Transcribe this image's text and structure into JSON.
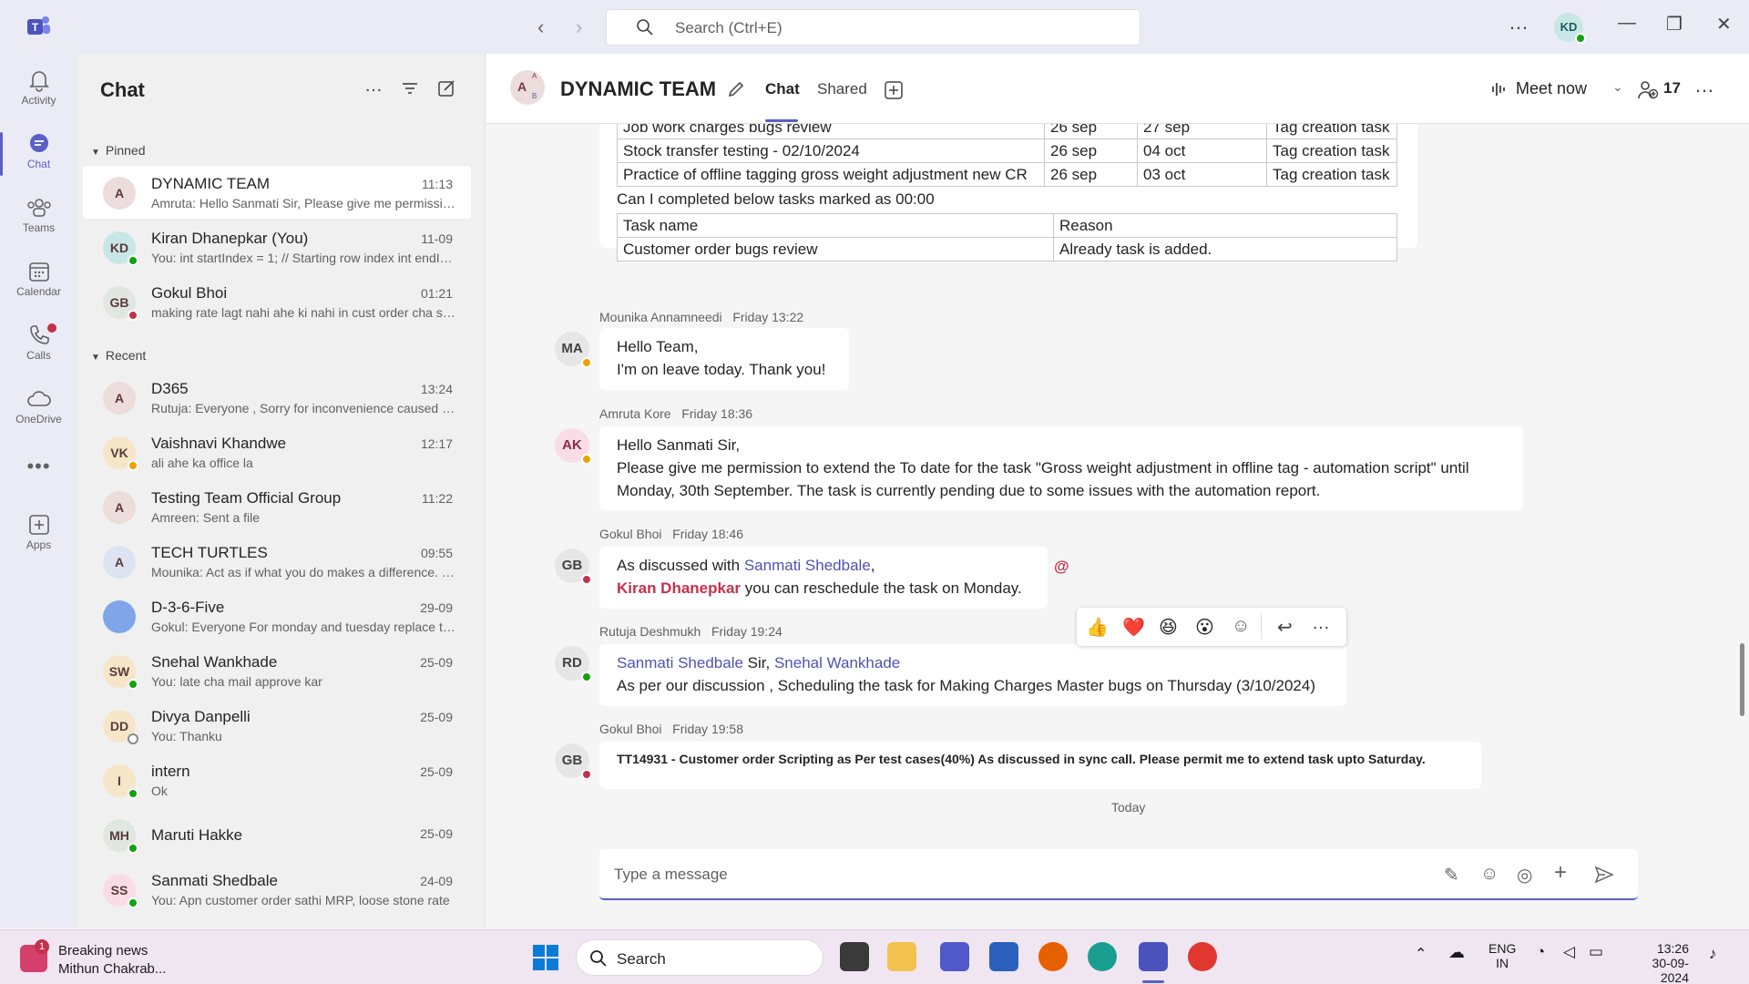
{
  "search": {
    "placeholder": "Search (Ctrl+E)"
  },
  "titlebar": {
    "user_initials": "KD"
  },
  "rail": [
    {
      "label": "Activity"
    },
    {
      "label": "Chat"
    },
    {
      "label": "Teams"
    },
    {
      "label": "Calendar"
    },
    {
      "label": "Calls"
    },
    {
      "label": "OneDrive"
    },
    {
      "label": "Apps"
    }
  ],
  "chatlist": {
    "title": "Chat",
    "pinned_label": "Pinned",
    "recent_label": "Recent",
    "pinned": [
      {
        "name": "DYNAMIC TEAM",
        "time": "11:13",
        "preview": "Amruta: Hello Sanmati Sir, Please give me permission to extend",
        "initials": "A",
        "avatar_color": "#eddcdc"
      },
      {
        "name": "Kiran Dhanepkar (You)",
        "time": "11-09",
        "preview": "You: int startIndex = 1; // Starting row index int endIndex",
        "initials": "KD",
        "avatar_color": "#c9e6e6"
      },
      {
        "name": "Gokul Bhoi",
        "time": "01:21",
        "preview": "making rate lagt nahi ahe ki nahi in cust order cha screen",
        "initials": "GB",
        "avatar_color": "#e0e6e0"
      }
    ],
    "recent": [
      {
        "name": "D365",
        "time": "13:24",
        "preview": "Rutuja: Everyone , Sorry for inconvenience caused today",
        "initials": "A",
        "avatar_color": "#eddcdc"
      },
      {
        "name": "Vaishnavi Khandwe",
        "time": "12:17",
        "preview": "ali ahe ka office la",
        "initials": "VK",
        "avatar_color": "#f5e6c8"
      },
      {
        "name": "Testing Team Official Group",
        "time": "11:22",
        "preview": "Amreen: Sent a file",
        "initials": "A",
        "avatar_color": "#eddcdc"
      },
      {
        "name": "TECH TURTLES",
        "time": "09:55",
        "preview": "Mounika: Act as if what you do makes a difference. It does.",
        "initials": "A",
        "avatar_color": "#dde3f0"
      },
      {
        "name": "D-3-6-Five",
        "time": "29-09",
        "preview": "Gokul: Everyone For monday and tuesday replace the tasks",
        "initials": "",
        "avatar_color": "#7fa6e8"
      },
      {
        "name": "Snehal Wankhade",
        "time": "25-09",
        "preview": "You: late cha mail approve kar",
        "initials": "SW",
        "avatar_color": "#f5e6c8"
      },
      {
        "name": "Divya Danpelli",
        "time": "25-09",
        "preview": "You: Thanku",
        "initials": "DD",
        "avatar_color": "#f5e6c8"
      },
      {
        "name": "intern",
        "time": "25-09",
        "preview": "Ok",
        "initials": "I",
        "avatar_color": "#f5e6c8"
      },
      {
        "name": "Maruti Hakke",
        "time": "25-09",
        "preview": "",
        "initials": "MH",
        "avatar_color": "#e0e6e0"
      },
      {
        "name": "Sanmati Shedbale",
        "time": "24-09",
        "preview": "You: Apn customer order sathi MRP, loose stone rate",
        "initials": "SS",
        "avatar_color": "#f8dde6"
      }
    ]
  },
  "header": {
    "title": "DYNAMIC TEAM",
    "tabs": [
      {
        "label": "Chat"
      },
      {
        "label": "Shared"
      }
    ],
    "meet_now": "Meet now",
    "participants": "17"
  },
  "messages": {
    "table1": [
      [
        "Job work charges bugs review",
        "26 sep",
        "27 sep",
        "Tag creation task"
      ],
      [
        "Stock transfer testing - 02/10/2024",
        "26 sep",
        "04 oct",
        "Tag creation task"
      ],
      [
        "Practice of offline tagging gross weight adjustment new CR",
        "26 sep",
        "03 oct",
        "Tag creation task"
      ]
    ],
    "table_caption": "Can I completed below tasks marked as 00:00",
    "table2": [
      [
        "Task name",
        "Reason"
      ],
      [
        "Customer order bugs review",
        "Already task is added."
      ]
    ],
    "m1": {
      "author": "Mounika Annamneedi",
      "time": "Friday 13:22",
      "initials": "MA",
      "line1": "Hello Team,",
      "line2": "I'm on leave today. Thank you!"
    },
    "m2": {
      "author": "Amruta Kore",
      "time": "Friday 18:36",
      "initials": "AK",
      "line1": "Hello Sanmati Sir,",
      "line2": "Please give me permission to extend the To date for the task \"Gross weight adjustment in offline tag - automation script\" until",
      "line3": "Monday, 30th September. The task is currently pending due to some issues with the automation report."
    },
    "m3": {
      "author": "Gokul Bhoi",
      "time": "Friday 18:46",
      "initials": "GB",
      "prefix": "As discussed with ",
      "mention1": "Sanmati Shedbale",
      "comma": ",",
      "mention2": "Kiran Dhanepkar",
      "rest": " you can reschedule the task on Monday.",
      "at_sign": "@"
    },
    "m4": {
      "author": "Rutuja Deshmukh",
      "time": "Friday 19:24",
      "initials": "RD",
      "mention1": "Sanmati Shedbale",
      "sir": " Sir, ",
      "mention2": "Snehal Wankhade",
      "line2": "As per our discussion , Scheduling the task for Making Charges Master bugs on Thursday (3/10/2024)"
    },
    "m5": {
      "author": "Gokul Bhoi",
      "time": "Friday 19:58",
      "initials": "GB",
      "text": "TT14931 - Customer order Scripting as Per test cases(40%) As discussed in sync call. Please permit me to extend task upto Saturday."
    },
    "divider": "Today"
  },
  "compose": {
    "placeholder": "Type a message"
  },
  "taskbar": {
    "news_badge": "1",
    "news_title": "Breaking news",
    "news_sub": "Mithun Chakrab...",
    "search_label": "Search",
    "lang1": "ENG",
    "lang2": "IN",
    "time": "13:26",
    "date": "30-09-2024"
  }
}
